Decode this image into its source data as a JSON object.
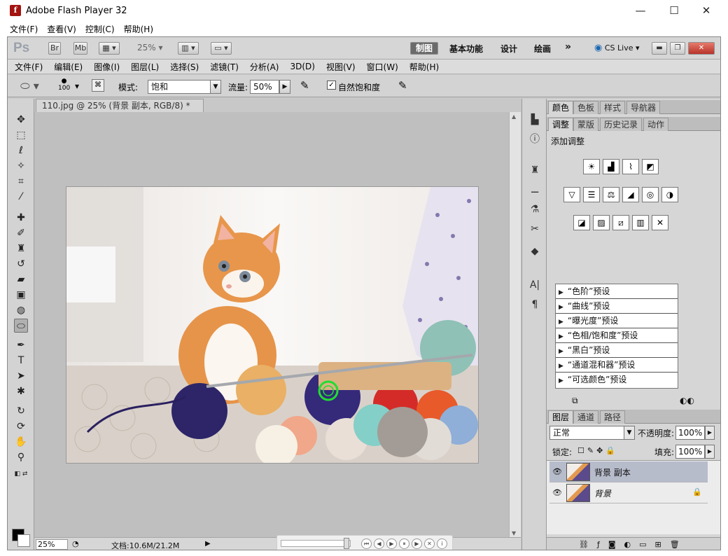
{
  "window": {
    "title": "Adobe Flash Player 32",
    "minimize": "—",
    "maximize": "☐",
    "close": "✕",
    "menu": [
      "文件(F)",
      "查看(V)",
      "控制(C)",
      "帮助(H)"
    ]
  },
  "appbar": {
    "logo": "Ps",
    "br": "Br",
    "mb": "Mb",
    "zoom": "25%",
    "workspaces": [
      "制图",
      "基本功能",
      "设计",
      "绘画"
    ],
    "more": "»",
    "cslive": "CS Live"
  },
  "ps_menu": [
    "文件(F)",
    "编辑(E)",
    "图像(I)",
    "图层(L)",
    "选择(S)",
    "滤镜(T)",
    "分析(A)",
    "3D(D)",
    "视图(V)",
    "窗口(W)",
    "帮助(H)"
  ],
  "options": {
    "brush_size": "100",
    "mode_label": "模式:",
    "mode_value": "饱和",
    "flow_label": "流量:",
    "flow_value": "50%",
    "vibrance_label": "自然饱和度"
  },
  "document": {
    "tab_title": "110.jpg @ 25% (背景 副本, RGB/8) *",
    "zoom": "25%",
    "doc_info": "文档:10.6M/21.2M"
  },
  "panels": {
    "top_tabs": [
      "颜色",
      "色板",
      "样式",
      "导航器"
    ],
    "adj_tabs": [
      "调整",
      "蒙版",
      "历史记录",
      "动作"
    ],
    "add_adjustment": "添加调整",
    "presets": [
      "“色阶”预设",
      "“曲线”预设",
      "“曝光度”预设",
      "“色相/饱和度”预设",
      "“黑白”预设",
      "“通道混和器”预设",
      "“可选颜色”预设"
    ],
    "layer_tabs": [
      "图层",
      "通道",
      "路径"
    ],
    "blend_mode": "正常",
    "opacity_label": "不透明度:",
    "opacity_value": "100%",
    "lock_label": "锁定:",
    "fill_label": "填充:",
    "fill_value": "100%",
    "layers": [
      "背景 副本",
      "背景"
    ]
  },
  "colors": {
    "ps_bg": "#c8c8c8",
    "selected_layer": "#b7bccb",
    "workspace_active": "#6b6b6b",
    "brush_circle": "#22dd33"
  }
}
